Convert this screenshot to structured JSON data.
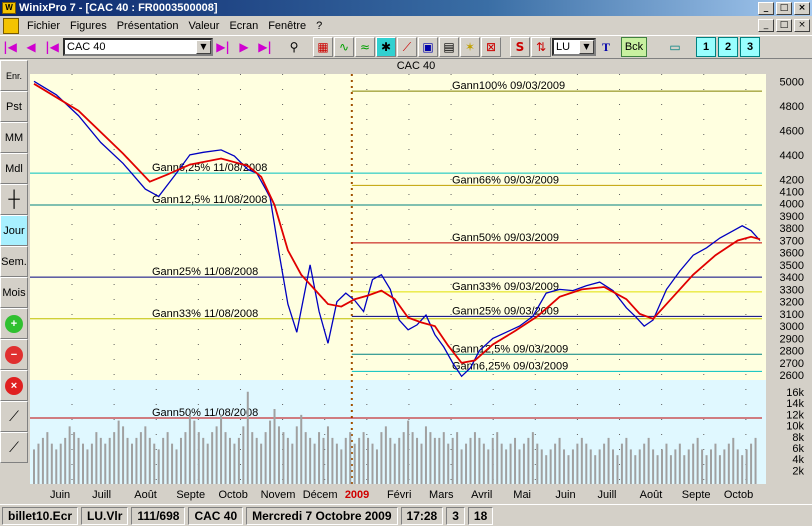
{
  "window": {
    "title": "WinixPro 7  - [CAC 40 : FR0003500008]",
    "min_label": "_",
    "max_label": "□",
    "close_label": "×"
  },
  "menu": {
    "items": [
      "Fichier",
      "Figures",
      "Présentation",
      "Valeur",
      "Ecran",
      "Fenêtre",
      "?"
    ]
  },
  "toolbar": {
    "instrument_value": "CAC 40",
    "period_value": "LU",
    "bck_label": "Bck",
    "window_buttons": [
      "1",
      "2",
      "3"
    ]
  },
  "sidebar": {
    "buttons": [
      {
        "name": "enr",
        "label": "Enr."
      },
      {
        "name": "pst",
        "label": "Pst"
      },
      {
        "name": "mm",
        "label": "MM"
      },
      {
        "name": "mdl",
        "label": "Mdl"
      },
      {
        "name": "grid",
        "label": ""
      },
      {
        "name": "jour",
        "label": "Jour",
        "active": true
      },
      {
        "name": "sem",
        "label": "Sem."
      },
      {
        "name": "mois",
        "label": "Mois"
      }
    ]
  },
  "chart_data": {
    "type": "line",
    "title": "CAC 40",
    "price_axis": {
      "ticks": [
        5000,
        4800,
        4600,
        4400,
        4200,
        4100,
        4000,
        3900,
        3800,
        3700,
        3600,
        3500,
        3400,
        3300,
        3200,
        3100,
        3000,
        2900,
        2800,
        2700,
        2600
      ],
      "range": [
        2560,
        5060
      ]
    },
    "volume_axis": {
      "ticks": [
        "16k",
        "14k",
        "12k",
        "10k",
        "8k",
        "6k",
        "4k",
        "2k"
      ]
    },
    "x_labels": [
      "Juin",
      "Juill",
      "Août",
      "Septe",
      "Octob",
      "Novem",
      "Décem",
      "2009",
      "Févri",
      "Mars",
      "Avril",
      "Mai",
      "Juin",
      "Juill",
      "Août",
      "Septe",
      "Octob"
    ],
    "year_marker": "2009",
    "series": [
      {
        "name": "price",
        "color": "#0000c0",
        "points": [
          [
            0,
            5000
          ],
          [
            5,
            4890
          ],
          [
            10,
            4720
          ],
          [
            15,
            4500
          ],
          [
            20,
            4330
          ],
          [
            25,
            4120
          ],
          [
            28,
            4060
          ],
          [
            32,
            4250
          ],
          [
            35,
            4400
          ],
          [
            38,
            4420
          ],
          [
            42,
            4440
          ],
          [
            45,
            4390
          ],
          [
            48,
            4280
          ],
          [
            50,
            4250
          ],
          [
            52,
            4120
          ],
          [
            53,
            4050
          ],
          [
            55,
            3600
          ],
          [
            57,
            3180
          ],
          [
            59,
            2950
          ],
          [
            62,
            3500
          ],
          [
            64,
            3120
          ],
          [
            66,
            2860
          ],
          [
            68,
            3200
          ],
          [
            70,
            3270
          ],
          [
            72,
            3210
          ],
          [
            74,
            3120
          ],
          [
            76,
            3380
          ],
          [
            78,
            3420
          ],
          [
            80,
            3300
          ],
          [
            82,
            3050
          ],
          [
            84,
            2970
          ],
          [
            86,
            3010
          ],
          [
            88,
            3090
          ],
          [
            90,
            2930
          ],
          [
            92,
            2830
          ],
          [
            94,
            2700
          ],
          [
            96,
            2590
          ],
          [
            98,
            2660
          ],
          [
            100,
            2800
          ],
          [
            103,
            2900
          ],
          [
            106,
            2950
          ],
          [
            109,
            3000
          ],
          [
            112,
            3080
          ],
          [
            115,
            3270
          ],
          [
            118,
            3300
          ],
          [
            121,
            3290
          ],
          [
            124,
            3330
          ],
          [
            127,
            3360
          ],
          [
            130,
            3290
          ],
          [
            133,
            3150
          ],
          [
            135,
            3080
          ],
          [
            137,
            3000
          ],
          [
            139,
            3050
          ],
          [
            142,
            3300
          ],
          [
            145,
            3450
          ],
          [
            148,
            3580
          ],
          [
            151,
            3640
          ],
          [
            154,
            3720
          ],
          [
            157,
            3780
          ],
          [
            159,
            3820
          ],
          [
            161,
            3780
          ],
          [
            163,
            3700
          ]
        ]
      },
      {
        "name": "moving-average",
        "color": "#e00000",
        "points": [
          [
            0,
            4980
          ],
          [
            10,
            4760
          ],
          [
            20,
            4410
          ],
          [
            26,
            4180
          ],
          [
            30,
            4240
          ],
          [
            35,
            4320
          ],
          [
            42,
            4370
          ],
          [
            48,
            4310
          ],
          [
            51,
            4220
          ],
          [
            54,
            3990
          ],
          [
            57,
            3620
          ],
          [
            60,
            3420
          ],
          [
            63,
            3300
          ],
          [
            66,
            3180
          ],
          [
            69,
            3160
          ],
          [
            72,
            3220
          ],
          [
            75,
            3250
          ],
          [
            78,
            3290
          ],
          [
            81,
            3220
          ],
          [
            84,
            3070
          ],
          [
            87,
            3030
          ],
          [
            90,
            3000
          ],
          [
            93,
            2840
          ],
          [
            96,
            2700
          ],
          [
            99,
            2720
          ],
          [
            103,
            2850
          ],
          [
            108,
            2960
          ],
          [
            113,
            3080
          ],
          [
            118,
            3240
          ],
          [
            123,
            3300
          ],
          [
            128,
            3320
          ],
          [
            133,
            3220
          ],
          [
            136,
            3100
          ],
          [
            139,
            3060
          ],
          [
            143,
            3220
          ],
          [
            148,
            3420
          ],
          [
            153,
            3580
          ],
          [
            158,
            3700
          ],
          [
            161,
            3730
          ],
          [
            163,
            3710
          ]
        ]
      }
    ],
    "gann_lines": [
      {
        "label": "Gann100% 09/03/2009",
        "value": 4920,
        "color": "#808000",
        "from": "2009"
      },
      {
        "label": "Gann6,25% 11/08/2008",
        "value": 4250,
        "color": "#00c0c0",
        "from": "start"
      },
      {
        "label": "Gann66% 09/03/2009",
        "value": 4150,
        "color": "#c0a000",
        "from": "2009"
      },
      {
        "label": "Gann12,5% 11/08/2008",
        "value": 3990,
        "color": "#008080",
        "from": "start"
      },
      {
        "label": "Gann50% 09/03/2009",
        "value": 3680,
        "color": "#c00000",
        "from": "2009"
      },
      {
        "label": "Gann25% 11/08/2008",
        "value": 3400,
        "color": "#000080",
        "from": "start"
      },
      {
        "label": "Gann33% 09/03/2009",
        "value": 3280,
        "color": "#e0e000",
        "from": "2009"
      },
      {
        "label": "Gann33% 11/08/2008",
        "value": 3060,
        "color": "#c0c000",
        "from": "start"
      },
      {
        "label": "Gann25% 09/03/2009",
        "value": 3080,
        "color": "#000080",
        "from": "2009"
      },
      {
        "label": "Gann12,5% 09/03/2009",
        "value": 2770,
        "color": "#008080",
        "from": "2009"
      },
      {
        "label": "Gann6,25% 09/03/2009",
        "value": 2630,
        "color": "#00c0c0",
        "from": "2009"
      }
    ],
    "volume_gann": {
      "label": "Gann50% 11/08/2008",
      "color": "#c00000"
    },
    "volume_values": [
      6,
      7,
      8,
      9,
      7,
      6,
      7,
      8,
      10,
      9,
      8,
      7,
      6,
      7,
      9,
      8,
      7,
      8,
      9,
      11,
      10,
      8,
      7,
      8,
      9,
      10,
      8,
      7,
      6,
      8,
      9,
      7,
      6,
      8,
      9,
      12,
      11,
      9,
      8,
      7,
      9,
      10,
      12,
      9,
      8,
      7,
      8,
      10,
      16,
      9,
      8,
      7,
      9,
      11,
      13,
      10,
      9,
      8,
      7,
      10,
      12,
      9,
      8,
      7,
      9,
      8,
      10,
      8,
      7,
      6,
      8,
      9,
      7,
      8,
      9,
      8,
      7,
      6,
      9,
      10,
      8,
      7,
      8,
      9,
      11,
      9,
      8,
      7,
      10,
      9,
      8,
      8,
      9,
      7,
      8,
      9,
      6,
      7,
      8,
      9,
      8,
      7,
      6,
      8,
      9,
      7,
      6,
      7,
      8,
      6,
      7,
      8,
      9,
      7,
      6,
      5,
      6,
      7,
      8,
      6,
      5,
      6,
      7,
      8,
      7,
      6,
      5,
      6,
      7,
      8,
      6,
      5,
      7,
      8,
      6,
      5,
      6,
      7,
      8,
      6,
      5,
      6,
      7,
      5,
      6,
      7,
      5,
      6,
      7,
      8,
      6,
      5,
      6,
      7,
      5,
      6,
      7,
      8,
      6,
      5,
      6,
      7,
      8
    ]
  },
  "status": {
    "file": "billet10.Ecr",
    "list": "LU.Vlr",
    "position": "111/698",
    "instrument": "CAC 40",
    "date": "Mercredi 7 Octobre 2009",
    "time": "17:28",
    "field1": "3",
    "field2": "18"
  }
}
